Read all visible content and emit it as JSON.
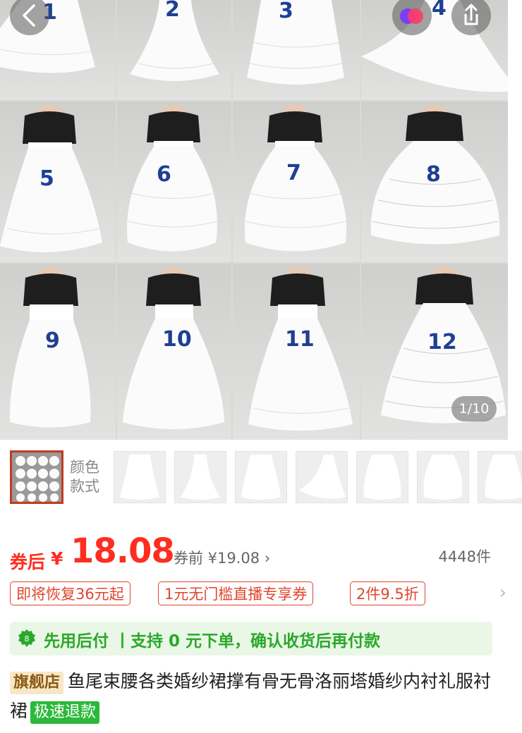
{
  "gallery": {
    "counter": "1/10",
    "labels": [
      "1",
      "2",
      "3",
      "4",
      "5",
      "6",
      "7",
      "8",
      "9",
      "10",
      "11",
      "12"
    ]
  },
  "variant": {
    "label_line1": "颜色",
    "label_line2": "款式"
  },
  "price": {
    "after_label": "券后",
    "currency": "¥",
    "value": "18.08",
    "before_text": "券前 ¥19.08",
    "before_chevron": "›",
    "sold": "4448件"
  },
  "promo_tags": [
    "即将恢复36元起",
    "1元无门槛直播专享券",
    "2件9.5折"
  ],
  "promo_more": "›",
  "pay_later": {
    "icon": "paylater-badge-icon",
    "text": "先用后付 丨支持 0 元下单，确认收货后再付款"
  },
  "product": {
    "store_badge": "旗舰店",
    "title": "鱼尾束腰各类婚纱裙撑有骨无骨洛丽塔婚纱内衬礼服衬裙",
    "refund_badge": "极速退款"
  },
  "colors": {
    "price_red": "#ff2d1f",
    "tag_red": "#e0452f",
    "paylater_green": "#2aa82a",
    "paylater_bg": "#eaf7e7",
    "refund_green": "#2cb93a"
  }
}
